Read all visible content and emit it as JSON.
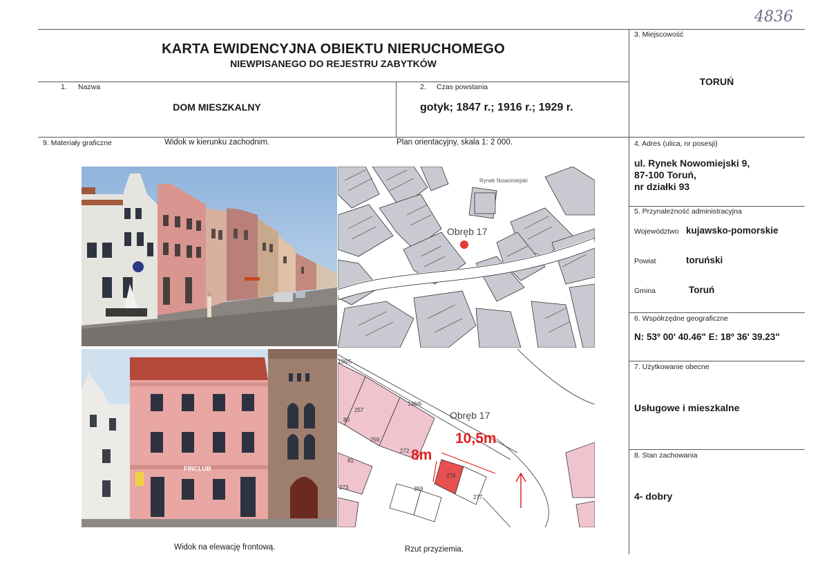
{
  "handwritten_number": "4836",
  "header": {
    "title": "KARTA EWIDENCYJNA OBIEKTU NIERUCHOMEGO",
    "subtitle": "NIEWPISANEGO DO REJESTRU ZABYTKÓW"
  },
  "field1": {
    "number": "1.",
    "label": "Nazwa",
    "value": "DOM MIESZKALNY"
  },
  "field2": {
    "number": "2.",
    "label": "Czas powstania",
    "value": "gotyk; 1847 r.; 1916 r.; 1929 r."
  },
  "field3": {
    "label": "3. Miejscowość",
    "value": "TORUŃ"
  },
  "field4": {
    "label": "4. Adres (ulica, nr posesji)",
    "line1": "ul. Rynek Nowomiejski 9,",
    "line2": "87-100 Toruń,",
    "line3": "nr działki 93"
  },
  "field5": {
    "label": "5. Przynależność administracyjna",
    "voivodeship_label": "Województwo",
    "voivodeship_value": "kujawsko-pomorskie",
    "county_label": "Powiat",
    "county_value": "toruński",
    "commune_label": "Gmina",
    "commune_value": "Toruń"
  },
  "field6": {
    "label": "6. Współrzędne geograficzne",
    "value": "N: 53º 00' 40.46\" E: 18º 36' 39.23\""
  },
  "field7": {
    "label": "7. Użytkowanie obecne",
    "value": "Usługowe i mieszkalne"
  },
  "field8": {
    "label": "8. Stan zachowania",
    "value": "4- dobry"
  },
  "field9": {
    "label": "9. Materiały graficzne",
    "caption_view_west": "Widok w kierunku zachodnim.",
    "caption_plan": "Plan orientacyjny, skala 1: 2 000.",
    "caption_elevation": "Widok na elewację frontową.",
    "caption_ground_plan": "Rzut przyziemia."
  },
  "map1": {
    "street_top": "Rynek Nowomiejski",
    "district": "Obręb 17"
  },
  "map2": {
    "district": "Obręb 17",
    "dim_long": "10,5m",
    "dim_short": "8m",
    "parcels": [
      "136/5",
      "136/6",
      "257",
      "80",
      "259",
      "81",
      "272",
      "273",
      "276",
      "277",
      "359"
    ],
    "marker_color": "#e53935",
    "dim_color": "#e02020"
  },
  "photo2": {
    "sign": "FINCLUB"
  },
  "colors": {
    "line": "#555555",
    "text": "#1a1a1a",
    "pink_facade": "#e8a7a3",
    "map_grey": "#c9c9d2",
    "map_pink": "#f0c4cf"
  }
}
